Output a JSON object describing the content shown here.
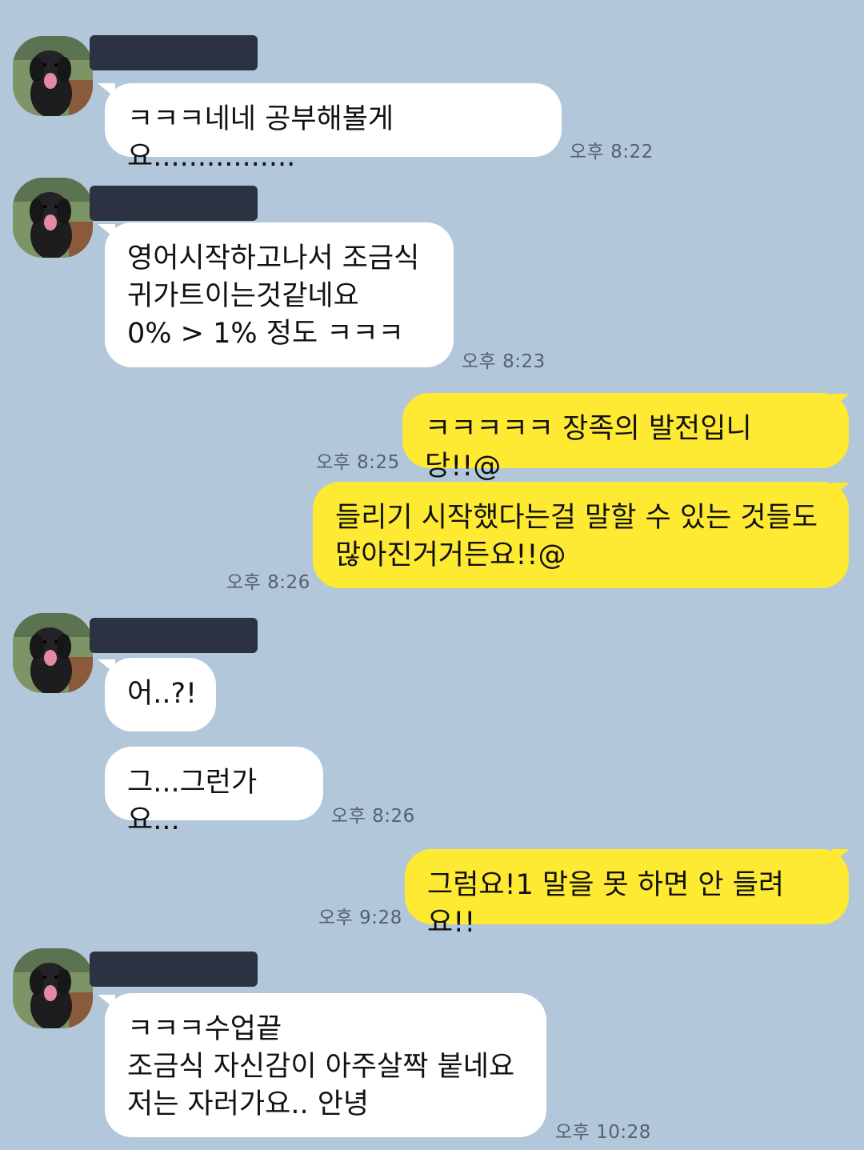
{
  "messages": [
    {
      "id": 1,
      "side": "in",
      "text": "ㅋㅋㅋ네네 공부해볼게요................",
      "time": "오후 8:22"
    },
    {
      "id": 2,
      "side": "in",
      "text": "영어시작하고나서 조금식\n귀가트이는것같네요\n0%  > 1% 정도 ㅋㅋㅋ",
      "time": "오후 8:23"
    },
    {
      "id": 3,
      "side": "out",
      "text": "ㅋㅋㅋㅋㅋ 장족의 발전입니당!!@",
      "time": "오후 8:25"
    },
    {
      "id": 4,
      "side": "out",
      "text": "들리기 시작했다는걸 말할 수 있는 것들도\n많아진거거든요!!@",
      "time": "오후 8:26"
    },
    {
      "id": 5,
      "side": "in",
      "text": "어..?!",
      "time": ""
    },
    {
      "id": 6,
      "side": "in",
      "text": "그...그런가요...",
      "time": "오후 8:26"
    },
    {
      "id": 7,
      "side": "out",
      "text": "그럼요!1 말을 못 하면 안 들려요!!",
      "time": "오후 9:28"
    },
    {
      "id": 8,
      "side": "in",
      "text": "ㅋㅋㅋ수업끝\n조금식 자신감이 아주살짝 붙네요\n저는 자러가요..  안녕",
      "time": "오후 10:28"
    }
  ],
  "icons": {
    "avatar": "dog-photo-avatar",
    "redacted_name": "redacted-name-bar"
  },
  "colors": {
    "background": "#b2c7da",
    "incoming_bubble": "#ffffff",
    "outgoing_bubble": "#fee933",
    "timestamp": "#556170",
    "redaction": "#2c3241"
  }
}
